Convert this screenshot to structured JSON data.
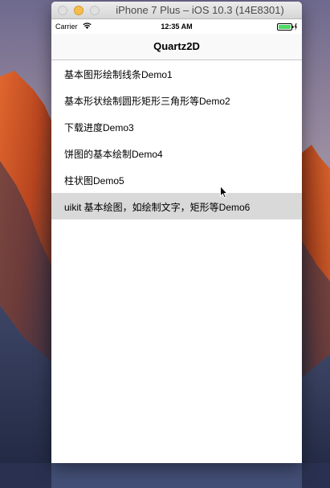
{
  "window": {
    "title": "iPhone 7 Plus – iOS 10.3 (14E8301)"
  },
  "status_bar": {
    "carrier": "Carrier",
    "time": "12:35 AM"
  },
  "nav": {
    "title": "Quartz2D"
  },
  "rows": [
    {
      "label": "基本图形绘制线条Demo1"
    },
    {
      "label": "基本形状绘制圆形矩形三角形等Demo2"
    },
    {
      "label": "下载进度Demo3"
    },
    {
      "label": "饼图的基本绘制Demo4"
    },
    {
      "label": "柱状图Demo5"
    },
    {
      "label": "uikit 基本绘图，如绘制文字，矩形等Demo6",
      "selected": true
    }
  ],
  "colors": {
    "selected_row": "#d9d9d9",
    "battery": "#4cd964",
    "minimize": "#f5bd4f"
  },
  "icons": [
    "wifi-icon",
    "battery-icon",
    "charging-bolt-icon",
    "mouse-cursor-icon"
  ]
}
